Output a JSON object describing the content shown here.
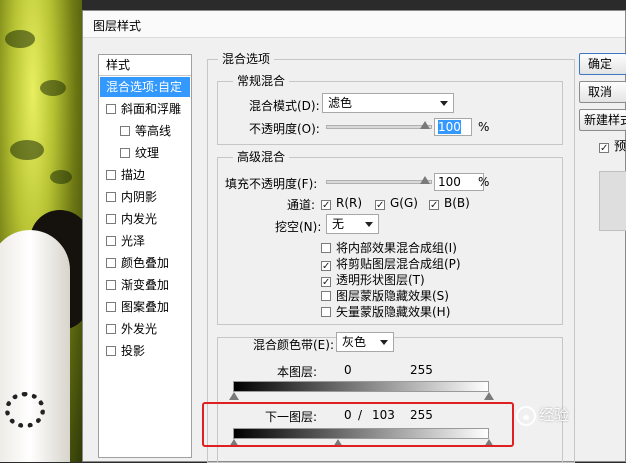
{
  "dialog": {
    "title": "图层样式"
  },
  "styles_panel": {
    "header": "样式",
    "items": [
      {
        "label": "混合选项:自定",
        "selected": true,
        "has_checkbox": false
      },
      {
        "label": "斜面和浮雕",
        "has_checkbox": true
      },
      {
        "label": "等高线",
        "has_checkbox": true,
        "indent": true
      },
      {
        "label": "纹理",
        "has_checkbox": true,
        "indent": true
      },
      {
        "label": "描边",
        "has_checkbox": true
      },
      {
        "label": "内阴影",
        "has_checkbox": true
      },
      {
        "label": "内发光",
        "has_checkbox": true
      },
      {
        "label": "光泽",
        "has_checkbox": true
      },
      {
        "label": "颜色叠加",
        "has_checkbox": true
      },
      {
        "label": "渐变叠加",
        "has_checkbox": true
      },
      {
        "label": "图案叠加",
        "has_checkbox": true
      },
      {
        "label": "外发光",
        "has_checkbox": true
      },
      {
        "label": "投影",
        "has_checkbox": true
      }
    ]
  },
  "blending_options": {
    "title": "混合选项",
    "general": {
      "title": "常规混合",
      "mode_label": "混合模式(D):",
      "mode_value": "滤色",
      "opacity_label": "不透明度(O):",
      "opacity_value": "100",
      "opacity_unit": "%"
    },
    "advanced": {
      "title": "高级混合",
      "fill_label": "填充不透明度(F):",
      "fill_value": "100",
      "fill_unit": "%",
      "channels_label": "通道:",
      "channel_r": "R(R)",
      "channel_g": "G(G)",
      "channel_b": "B(B)",
      "knockout_label": "挖空(N):",
      "knockout_value": "无",
      "options": [
        {
          "label": "将内部效果混合成组(I)",
          "checked": false
        },
        {
          "label": "将剪贴图层混合成组(P)",
          "checked": true
        },
        {
          "label": "透明形状图层(T)",
          "checked": true
        },
        {
          "label": "图层蒙版隐藏效果(S)",
          "checked": false
        },
        {
          "label": "矢量蒙版隐藏效果(H)",
          "checked": false
        }
      ]
    },
    "blend_if": {
      "label": "混合颜色带(E):",
      "value": "灰色",
      "this_layer_label": "本图层:",
      "this_layer_low": "0",
      "this_layer_high": "255",
      "underlying_label": "下一图层:",
      "underlying_low": "0",
      "underlying_sep": "/",
      "underlying_split": "103",
      "underlying_high": "255"
    }
  },
  "buttons": {
    "ok": "确定",
    "cancel": "取消",
    "new_style": "新建样式...",
    "preview": "预览"
  },
  "watermark": "经验"
}
